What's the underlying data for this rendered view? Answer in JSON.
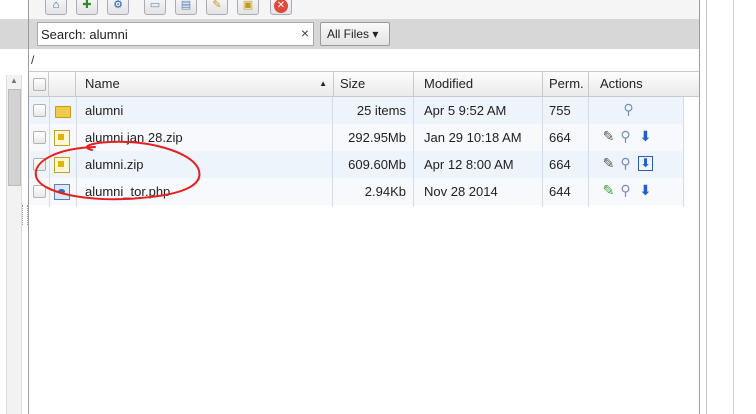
{
  "toolbar": {
    "buttons": [
      "home-icon",
      "new-folder-icon",
      "sitemap-icon",
      "window-icon",
      "upload-icon",
      "edit-icon",
      "image-icon",
      "delete-icon"
    ]
  },
  "search": {
    "value": "alumni",
    "prefix": "Search:",
    "clear_glyph": "×"
  },
  "filter": {
    "label": "All Files",
    "arrow": "▾"
  },
  "path": "/",
  "columns": {
    "name": "Name",
    "sort_arrow": "▲",
    "size": "Size",
    "modified": "Modified",
    "perm": "Perm.",
    "actions": "Actions"
  },
  "rows": [
    {
      "name": "alumni",
      "size": "25 items",
      "modified": "Apr 5 9:52 AM",
      "perm": "755",
      "type": "folder"
    },
    {
      "name": "alumni jan 28.zip",
      "size": "292.95Mb",
      "modified": "Jan 29 10:18 AM",
      "perm": "664",
      "type": "zip"
    },
    {
      "name": "alumni.zip",
      "size": "609.60Mb",
      "modified": "Apr 12 8:00 AM",
      "perm": "664",
      "type": "zip"
    },
    {
      "name": "alumni_tor.php",
      "size": "2.94Kb",
      "modified": "Nov 28 2014",
      "perm": "644",
      "type": "php"
    }
  ],
  "icons": {
    "edit": "✎",
    "view": "🔍",
    "download": "⬇"
  },
  "colors": {
    "annotation": "#e32121",
    "row_odd": "#eef4fb",
    "row_even": "#f7f9fc",
    "header_band": "#d7d7d7"
  }
}
